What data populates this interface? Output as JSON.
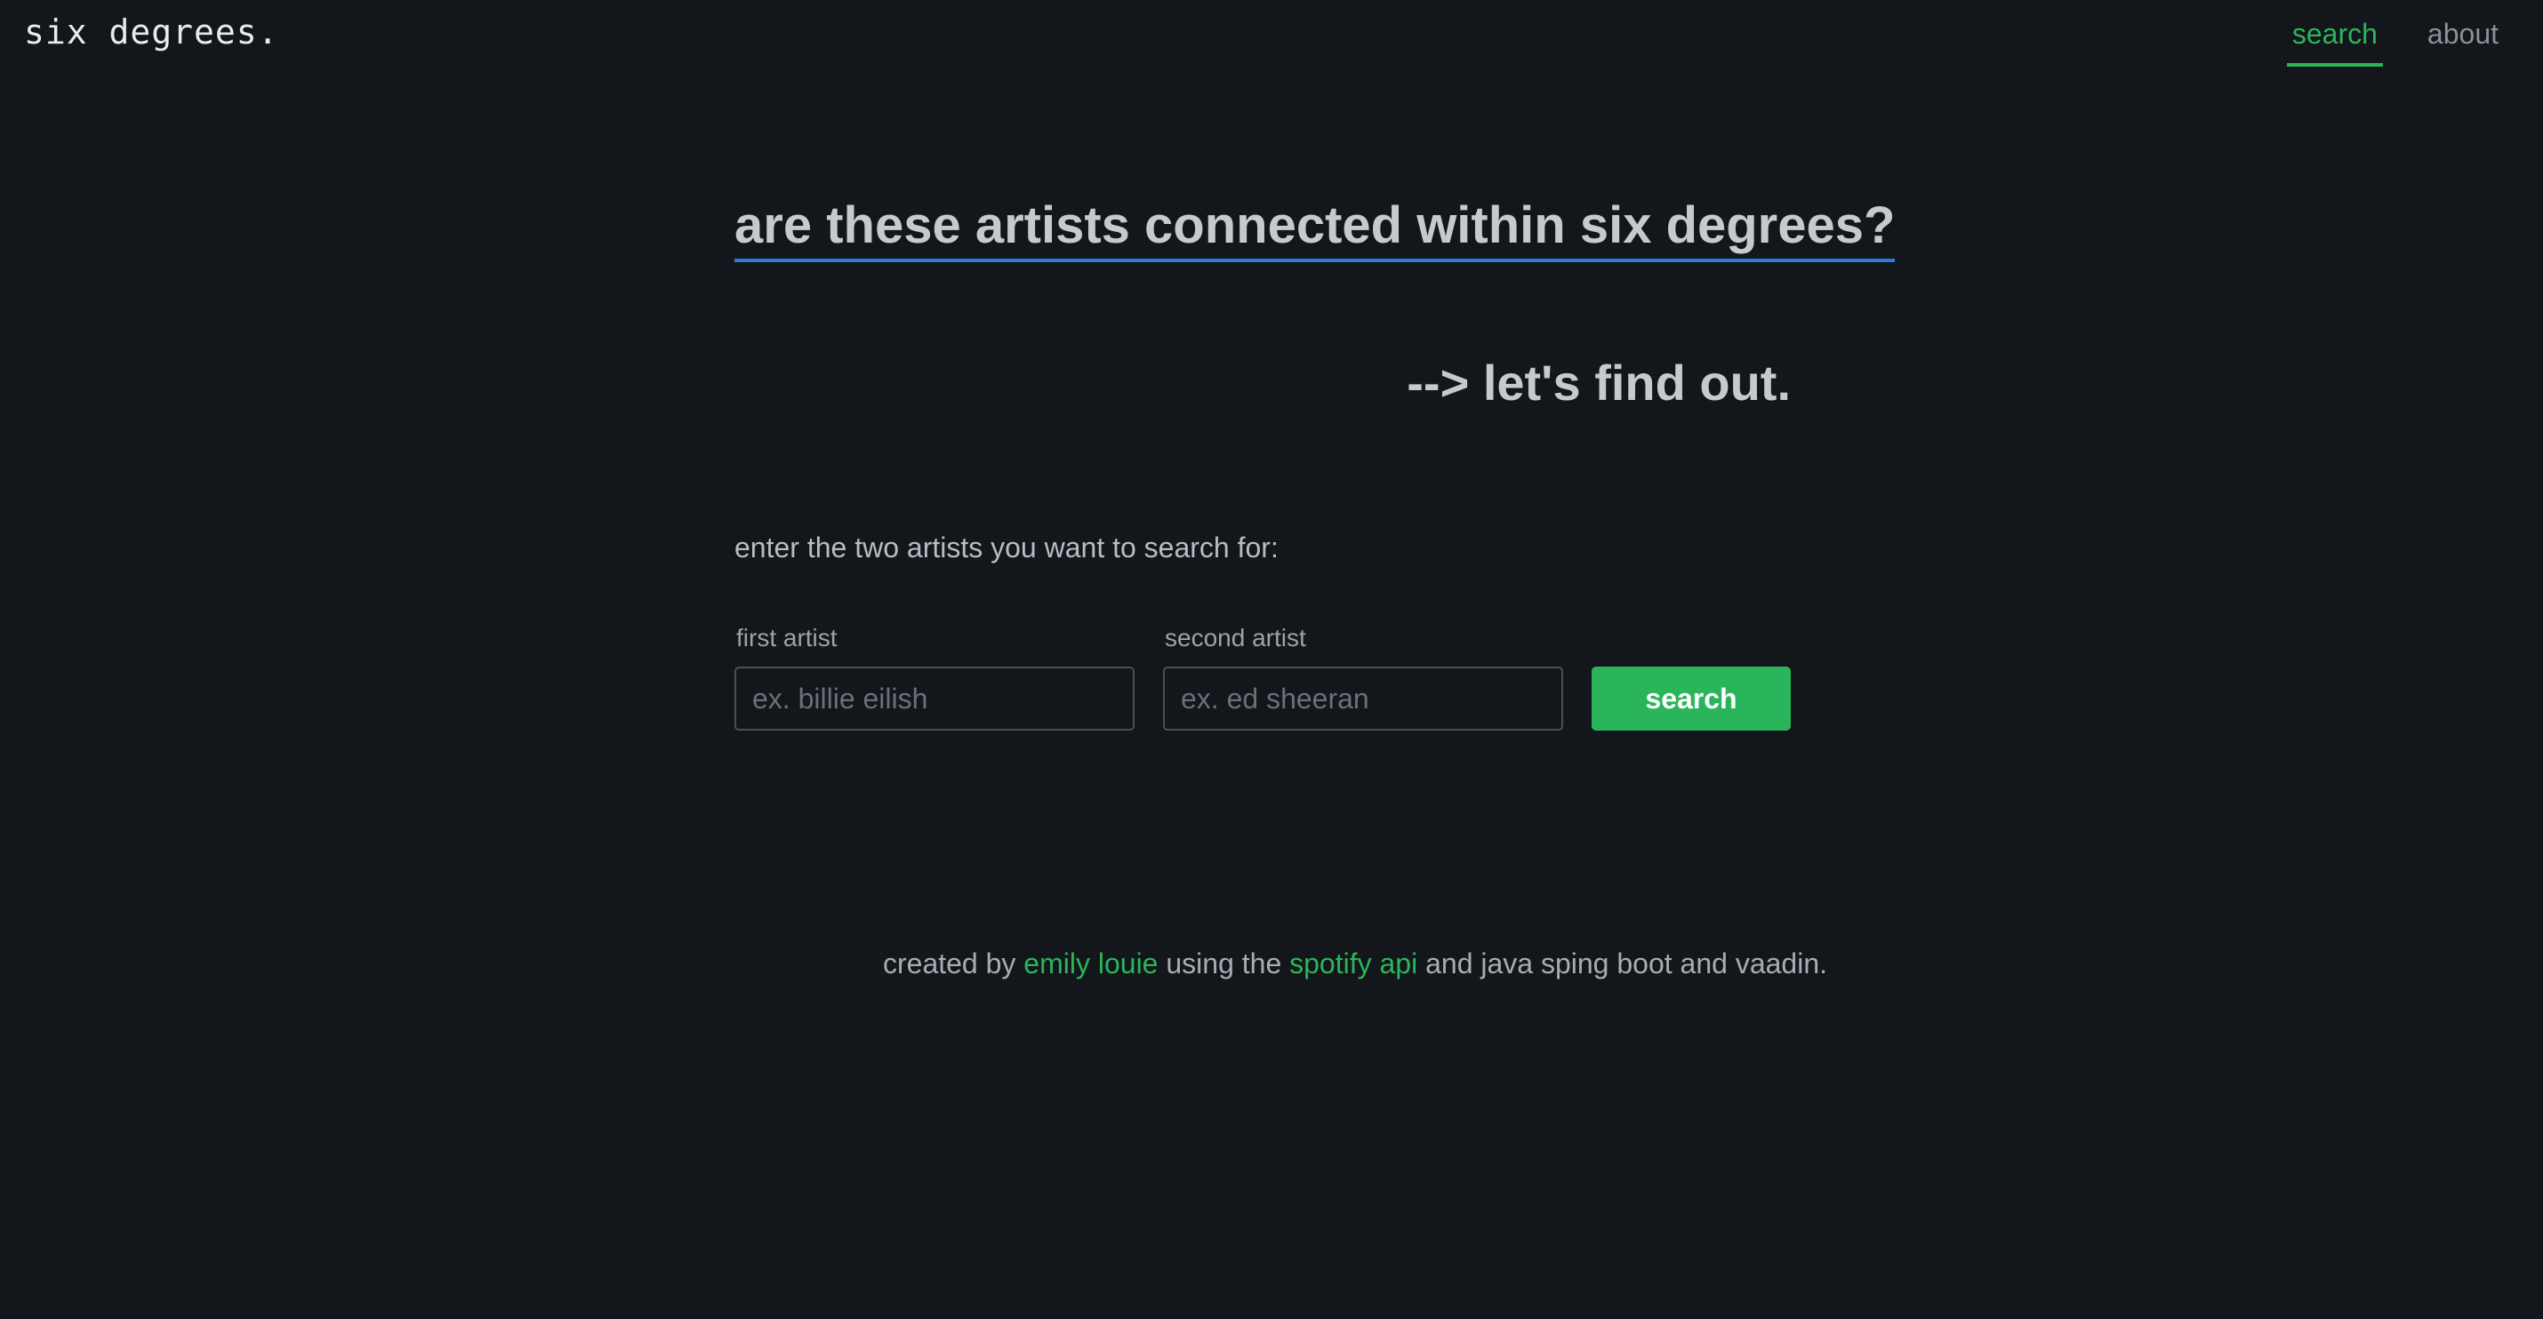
{
  "header": {
    "logo": "six degrees.",
    "nav": [
      {
        "label": "search",
        "active": true
      },
      {
        "label": "about",
        "active": false
      }
    ]
  },
  "main": {
    "headline": "are these artists connected within six degrees?",
    "subhead": "--> let's find out.",
    "prompt": "enter the two artists you want to search for:",
    "first_artist": {
      "label": "first artist",
      "value": "",
      "placeholder": "ex. billie eilish"
    },
    "second_artist": {
      "label": "second artist",
      "value": "",
      "placeholder": "ex. ed sheeran"
    },
    "search_label": "search"
  },
  "footer": {
    "text_1": "created by ",
    "author_link": "emily louie",
    "text_2": " using the ",
    "api_link": "spotify api",
    "text_3": " and java sping boot and vaadin."
  },
  "colors": {
    "background": "#13161b",
    "accent_green": "#2bb55a",
    "underline_blue": "#2f79d7"
  }
}
